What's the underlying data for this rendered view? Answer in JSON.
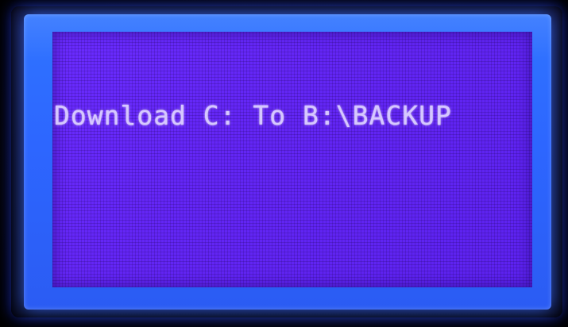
{
  "display": {
    "message": "Download C: To B:\\BACKUP"
  },
  "colors": {
    "backlight": "#2d66ff",
    "lcd_background": "#6326f5",
    "text": "#d6c8ff"
  }
}
